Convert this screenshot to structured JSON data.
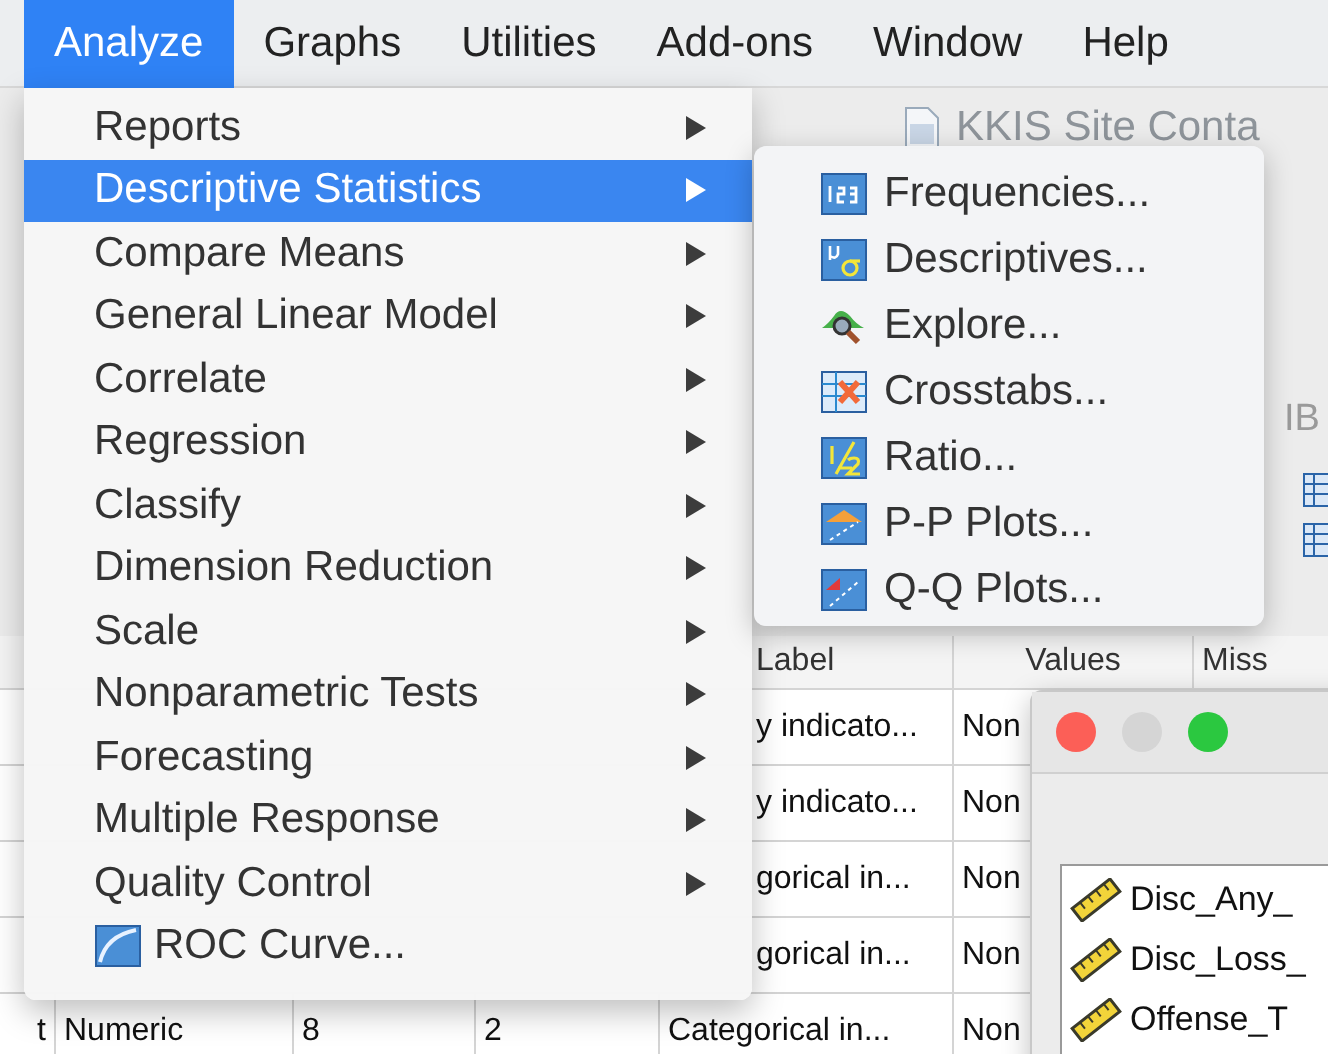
{
  "menubar": [
    {
      "label": "Analyze",
      "selected": true
    },
    {
      "label": "Graphs",
      "selected": false
    },
    {
      "label": "Utilities",
      "selected": false
    },
    {
      "label": "Add-ons",
      "selected": false
    },
    {
      "label": "Window",
      "selected": false
    },
    {
      "label": "Help",
      "selected": false
    }
  ],
  "background_window": {
    "title": "KKIS Site Conta",
    "second_title": "IB"
  },
  "table": {
    "columns": [
      {
        "label": "Label"
      },
      {
        "label": "Values"
      },
      {
        "label": "Miss"
      }
    ],
    "rows": [
      {
        "label": "y indicato...",
        "values": "Non"
      },
      {
        "label": "y indicato...",
        "values": "Non"
      },
      {
        "label": "gorical in...",
        "values": "Non"
      },
      {
        "label": "gorical in...",
        "values": "Non"
      }
    ],
    "last_row": {
      "column_1": "t",
      "column_2": "Numeric",
      "column_3": "8",
      "column_4": "2",
      "label": "Categorical in...",
      "values": "Non"
    }
  },
  "analyze_menu": [
    {
      "label": "Reports",
      "kind": "submenu",
      "selected": false
    },
    {
      "label": "Descriptive Statistics",
      "kind": "submenu",
      "selected": true
    },
    {
      "label": "Compare Means",
      "kind": "submenu",
      "selected": false
    },
    {
      "label": "General Linear Model",
      "kind": "submenu",
      "selected": false
    },
    {
      "label": "Correlate",
      "kind": "submenu",
      "selected": false
    },
    {
      "label": "Regression",
      "kind": "submenu",
      "selected": false
    },
    {
      "label": "Classify",
      "kind": "submenu",
      "selected": false
    },
    {
      "label": "Dimension Reduction",
      "kind": "submenu",
      "selected": false
    },
    {
      "label": "Scale",
      "kind": "submenu",
      "selected": false
    },
    {
      "label": "Nonparametric Tests",
      "kind": "submenu",
      "selected": false
    },
    {
      "label": "Forecasting",
      "kind": "submenu",
      "selected": false
    },
    {
      "label": "Multiple Response",
      "kind": "submenu",
      "selected": false
    },
    {
      "label": "Quality Control",
      "kind": "submenu",
      "selected": false
    },
    {
      "label": "ROC Curve...",
      "kind": "command",
      "selected": false
    }
  ],
  "descriptive_statistics_submenu": [
    {
      "label": "Frequencies..."
    },
    {
      "label": "Descriptives..."
    },
    {
      "label": "Explore..."
    },
    {
      "label": "Crosstabs..."
    },
    {
      "label": "Ratio..."
    },
    {
      "label": "P-P Plots..."
    },
    {
      "label": "Q-Q Plots..."
    }
  ],
  "variables_dialog": {
    "variables": [
      {
        "name": "Disc_Any_"
      },
      {
        "name": "Disc_Loss_"
      },
      {
        "name": "Offense_T"
      }
    ]
  }
}
